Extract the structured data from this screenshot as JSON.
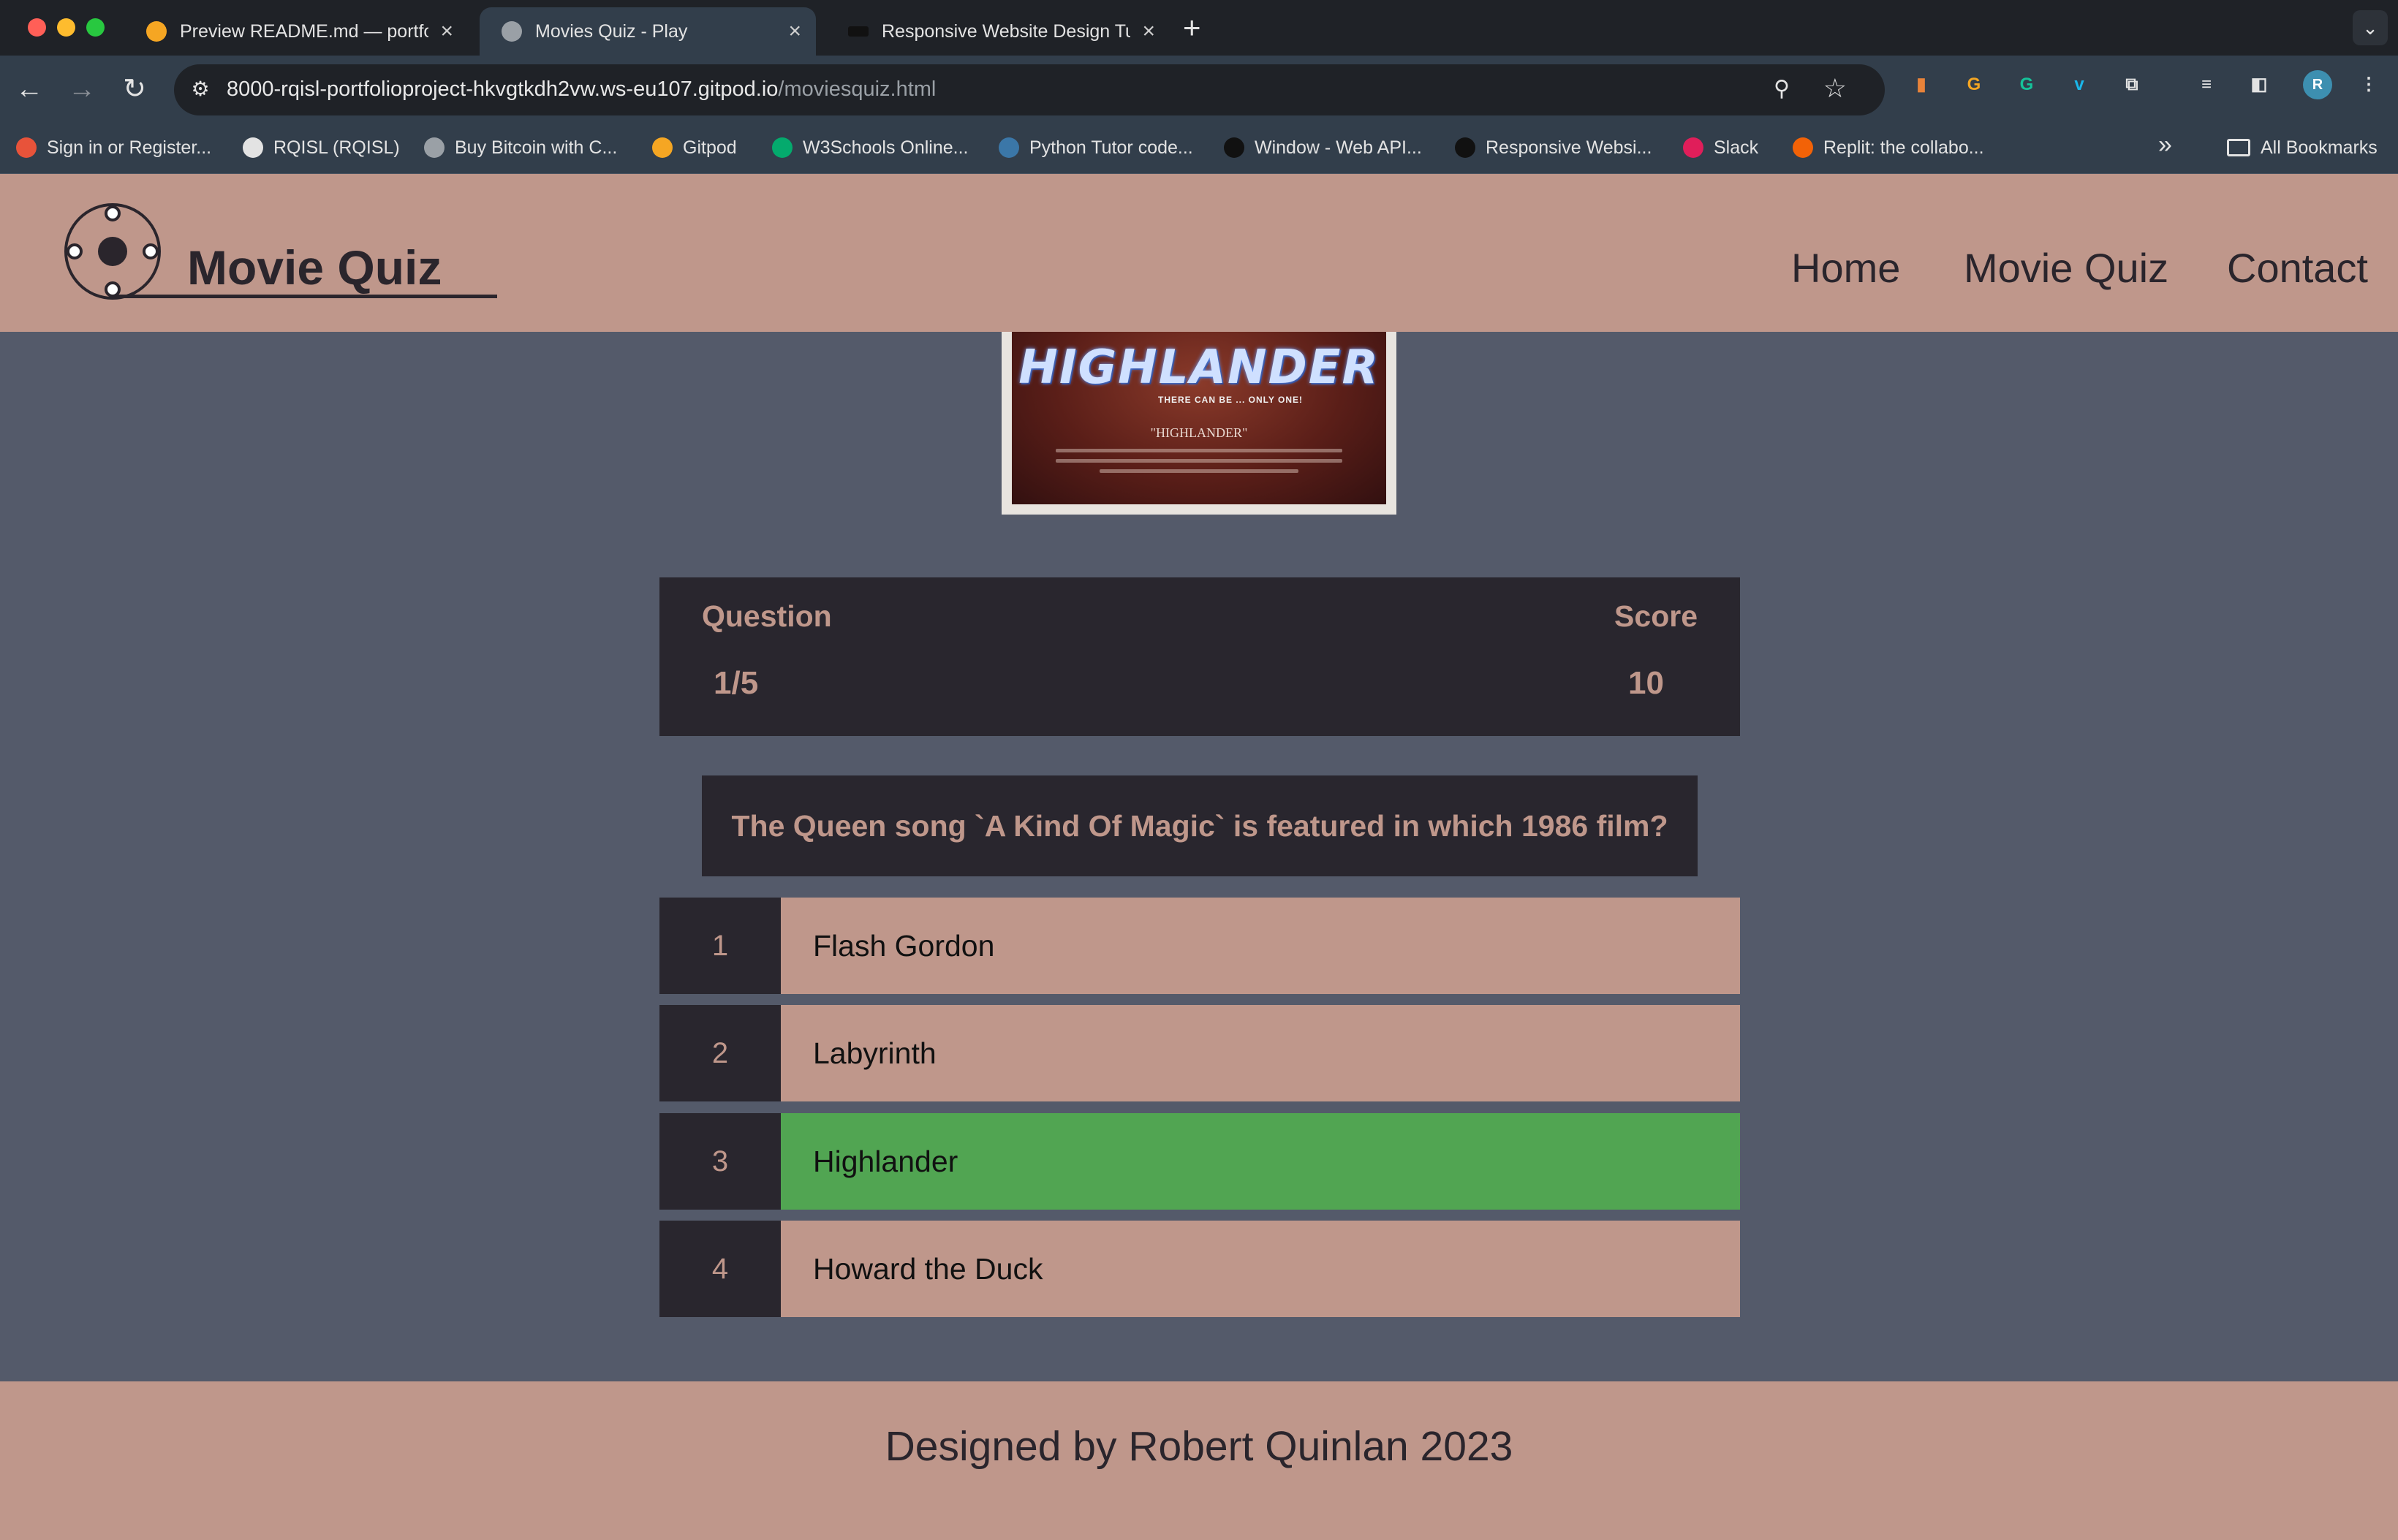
{
  "browser": {
    "tabs": [
      {
        "title": "Preview README.md — portfolio",
        "favicon_color": "#f5a623",
        "close": "×"
      },
      {
        "title": "Movies Quiz - Play",
        "favicon_color": "#9aa0a6",
        "close": "×"
      },
      {
        "title": "Responsive Website Design Tutorial",
        "favicon_color": "#111111",
        "close": "×"
      }
    ],
    "new_tab": "+",
    "tab_menu": "⌄",
    "nav": {
      "back": "←",
      "forward": "→",
      "reload": "↻"
    },
    "url_host": "8000-rqisl-portfolioproject-hkvgtkdh2vw.ws-eu107.gitpod.io",
    "url_path": "/moviesquiz.html",
    "site_settings_icon": "⚙",
    "zoom_icon": "⚲",
    "star_icon": "☆",
    "extensions": [
      {
        "glyph": "▮",
        "color": "#e8833a"
      },
      {
        "glyph": "G",
        "color": "#f5a623"
      },
      {
        "glyph": "G",
        "color": "#15c39a"
      },
      {
        "glyph": "v",
        "color": "#1ab7ea"
      },
      {
        "glyph": "⧉",
        "color": "#e3e3e3"
      },
      {
        "glyph": "≡",
        "color": "#e3e3e3"
      },
      {
        "glyph": "◧",
        "color": "#e3e3e3"
      },
      {
        "glyph": "R",
        "color": "#3d8fb0"
      },
      {
        "glyph": "⋮",
        "color": "#e3e3e3"
      }
    ],
    "bookmarks": [
      {
        "label": "Sign in or Register...",
        "color": "#e8533a"
      },
      {
        "label": "RQISL (RQISL)",
        "color": "#e3e3e3"
      },
      {
        "label": "Buy Bitcoin with C...",
        "color": "#9aa0a6"
      },
      {
        "label": "Gitpod",
        "color": "#f5a623"
      },
      {
        "label": "W3Schools Online...",
        "color": "#04aa6d"
      },
      {
        "label": "Python Tutor code...",
        "color": "#3b77a8"
      },
      {
        "label": "Window - Web API...",
        "color": "#111111"
      },
      {
        "label": "Responsive Websi...",
        "color": "#111111"
      },
      {
        "label": "Slack",
        "color": "#e01e5a"
      },
      {
        "label": "Replit: the collabo...",
        "color": "#f26207"
      }
    ],
    "more_bookmarks": "»",
    "all_bookmarks": "All Bookmarks"
  },
  "header": {
    "brand": "Movie Quiz",
    "nav": [
      "Home",
      "Movie Quiz",
      "Contact"
    ]
  },
  "poster": {
    "title": "HIGHLANDER",
    "tagline": "THERE CAN BE ... ONLY ONE!",
    "subtitle": "\"HIGHLANDER\""
  },
  "hud": {
    "question_label": "Question",
    "question_value": "1/5",
    "score_label": "Score",
    "score_value": "10"
  },
  "question": "The Queen song `A Kind Of Magic` is featured in which 1986 film?",
  "choices": [
    {
      "number": "1",
      "text": "Flash Gordon"
    },
    {
      "number": "2",
      "text": "Labyrinth"
    },
    {
      "number": "3",
      "text": "Highlander"
    },
    {
      "number": "4",
      "text": "Howard the Duck"
    }
  ],
  "colors": {
    "page_bg": "#545a6a",
    "accent": "#bf978b",
    "dark_panel": "#29262e",
    "correct": "#51a552"
  },
  "footer": "Designed by Robert Quinlan 2023"
}
